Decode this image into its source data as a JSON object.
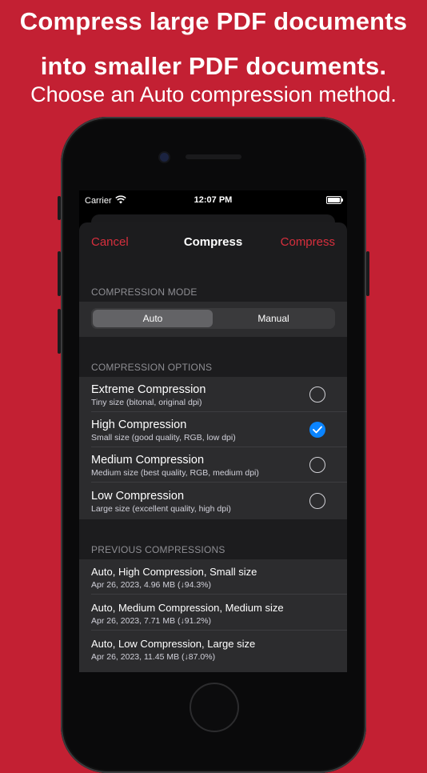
{
  "promo": {
    "line1": "Compress large PDF documents",
    "line2": "into smaller PDF documents.",
    "subtitle": "Choose an Auto compression method."
  },
  "status_bar": {
    "carrier": "Carrier",
    "time": "12:07 PM"
  },
  "nav": {
    "cancel": "Cancel",
    "title": "Compress",
    "compress": "Compress"
  },
  "compression_mode": {
    "header": "COMPRESSION MODE",
    "options": [
      "Auto",
      "Manual"
    ],
    "selected": "Auto"
  },
  "compression_options": {
    "header": "COMPRESSION OPTIONS",
    "items": [
      {
        "title": "Extreme Compression",
        "detail": "Tiny size (bitonal, original dpi)",
        "checked": false
      },
      {
        "title": "High Compression",
        "detail": "Small size (good quality, RGB, low dpi)",
        "checked": true
      },
      {
        "title": "Medium Compression",
        "detail": "Medium size (best quality, RGB, medium dpi)",
        "checked": false
      },
      {
        "title": "Low Compression",
        "detail": "Large size (excellent quality, high dpi)",
        "checked": false
      }
    ]
  },
  "previous_compressions": {
    "header": "PREVIOUS COMPRESSIONS",
    "items": [
      {
        "title": "Auto, High Compression, Small size",
        "detail": "Apr 26, 2023, 4.96 MB (↓94.3%)"
      },
      {
        "title": "Auto, Medium Compression, Medium size",
        "detail": "Apr 26, 2023, 7.71 MB (↓91.2%)"
      },
      {
        "title": "Auto, Low Compression, Large size",
        "detail": "Apr 26, 2023, 11.45 MB (↓87.0%)"
      }
    ]
  },
  "colors": {
    "background": "#c32033",
    "accent": "#d72f3d",
    "check": "#0a84ff"
  }
}
